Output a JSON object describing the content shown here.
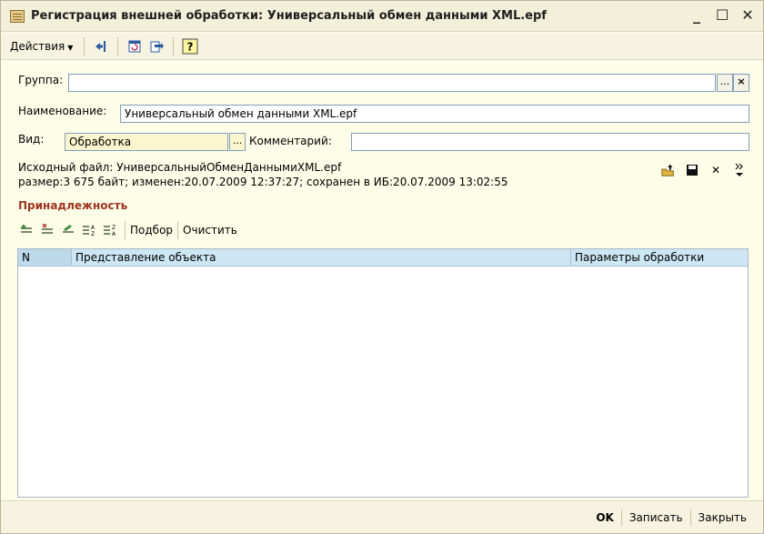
{
  "window": {
    "title": "Регистрация внешней обработки: Универсальный обмен данными XML.epf",
    "controls": {
      "minimize": "_",
      "maximize": "☐",
      "close": "✕"
    }
  },
  "toolbar": {
    "actions_menu": "Действия",
    "icons": [
      "move-left-icon",
      "calendar-icon",
      "export-icon",
      "help-icon"
    ]
  },
  "form": {
    "group_label": "Группа:",
    "group_value": "",
    "name_label": "Наименование:",
    "name_value": "Универсальный обмен данными XML.epf",
    "kind_label": "Вид:",
    "kind_value": "Обработка",
    "comment_label": "Комментарий:",
    "comment_value": "",
    "select_button": "...",
    "clear_button": "×"
  },
  "file_info": {
    "source_line": "Исходный файл: УниверсальныйОбменДаннымиXML.epf",
    "details_line": "размер:3 675 байт; изменен:20.07.2009 12:37:27; сохранен в ИБ:20.07.2009 13:02:55"
  },
  "belonging": {
    "title": "Принадлежность",
    "select_label": "Подбор",
    "clear_label": "Очистить",
    "columns": [
      "N",
      "Представление объекта",
      "Параметры обработки"
    ],
    "rows": []
  },
  "footer": {
    "ok": "OK",
    "save": "Записать",
    "close": "Закрыть"
  }
}
